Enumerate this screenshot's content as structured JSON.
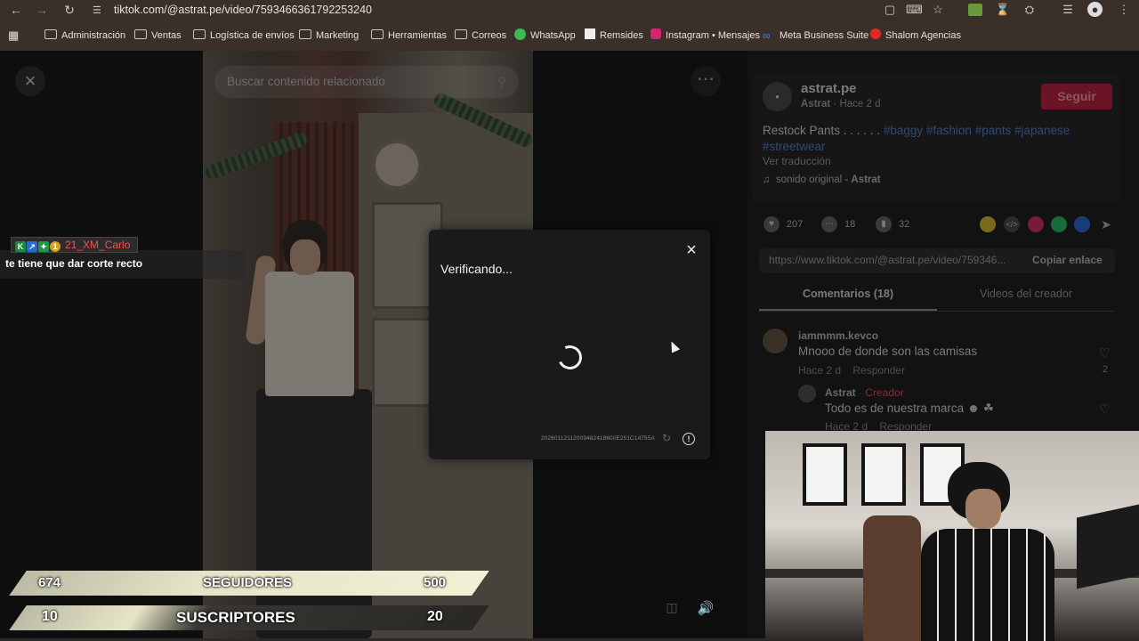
{
  "browser": {
    "url": "tiktok.com/@astrat.pe/video/7593466361792253240",
    "bookmarks": [
      {
        "label": "Administración",
        "icon": "folder-icon"
      },
      {
        "label": "Ventas",
        "icon": "folder-icon"
      },
      {
        "label": "Logística de envíos",
        "icon": "folder-icon"
      },
      {
        "label": "Marketing",
        "icon": "folder-icon"
      },
      {
        "label": "Herramientas",
        "icon": "folder-icon"
      },
      {
        "label": "Correos",
        "icon": "folder-icon"
      },
      {
        "label": "WhatsApp",
        "icon": "whatsapp-icon"
      },
      {
        "label": "Remsides",
        "icon": "remsides-icon"
      },
      {
        "label": "Instagram • Mensajes",
        "icon": "instagram-icon"
      },
      {
        "label": "Meta Business Suite",
        "icon": "meta-icon"
      },
      {
        "label": "Shalom Agencias",
        "icon": "shalom-icon"
      }
    ]
  },
  "video": {
    "search_placeholder": "Buscar contenido relacionado"
  },
  "post": {
    "username": "astrat.pe",
    "display_name": "Astrat",
    "time": "Hace 2 d",
    "follow_label": "Seguir",
    "caption_text": "Restock Pants . . . . . .",
    "hashtags": [
      "#baggy",
      "#fashion",
      "#pants",
      "#japanese",
      "#streetwear"
    ],
    "translate_label": "Ver traducción",
    "sound_label": "sonido original - ",
    "sound_author": "Astrat",
    "likes": "207",
    "comments": "18",
    "saves": "32",
    "link": "https://www.tiktok.com/@astrat.pe/video/759346...",
    "copy_label": "Copiar enlace",
    "tab_comments": "Comentarios (18)",
    "tab_videos": "Videos del creador"
  },
  "comments": [
    {
      "user": "iammmm.kevco",
      "text": "Mnooo de donde son las camisas",
      "time": "Hace 2 d",
      "reply": "Responder",
      "likes": "2"
    },
    {
      "user": "Astrat",
      "creator_label": "Creador",
      "text": "Todo es de nuestra marca",
      "time": "Hace 2 d",
      "reply": "Responder",
      "likes": "0"
    }
  ],
  "modal": {
    "title": "Verificando...",
    "code": "20260112112009482418600E251C14755A"
  },
  "stream": {
    "chat_user": "21_XM_Carlo",
    "chat_message": "te tiene que dar corte recto",
    "followers_current": "674",
    "followers_label": "SEGUIDORES",
    "followers_goal": "500",
    "subs_current": "10",
    "subs_label": "SUSCRIPTORES",
    "subs_goal": "20"
  },
  "colors": {
    "follow_button": "#6a1425",
    "hashtag": "#2e4a72",
    "creator_badge": "#8a2a33",
    "chat_user": "#ff4b4b"
  }
}
